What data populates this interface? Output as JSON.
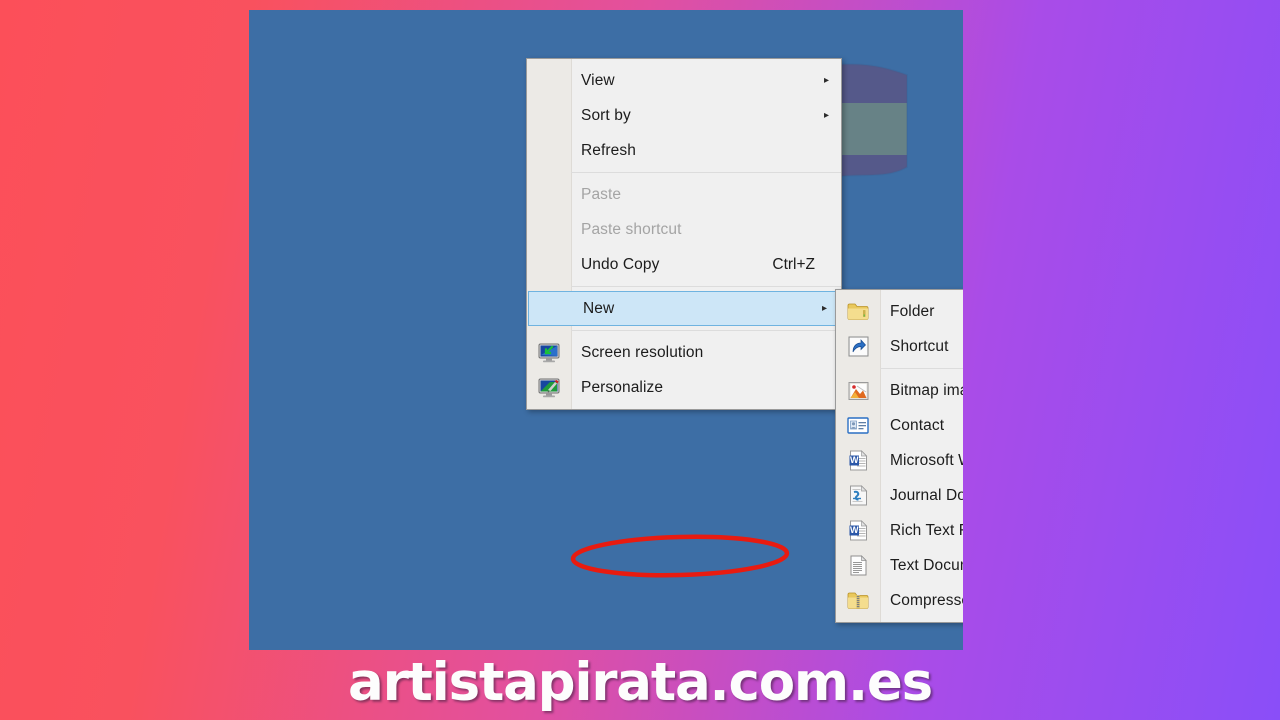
{
  "background": {
    "gradient_from": "#fc4f59",
    "gradient_to": "#8a4ef8",
    "desktop_color": "#3d6ea5"
  },
  "wallpaper": {
    "name": "spain-flag-wallpaper",
    "description": "Waving Spanish flag"
  },
  "context_menu": {
    "name": "desktop-context-menu",
    "items": [
      {
        "label": "View",
        "accel": "",
        "arrow": "▸",
        "state": "normal",
        "icon": ""
      },
      {
        "label": "Sort by",
        "accel": "",
        "arrow": "▸",
        "state": "normal",
        "icon": ""
      },
      {
        "label": "Refresh",
        "accel": "",
        "arrow": "",
        "state": "normal",
        "icon": ""
      },
      {
        "label": "Paste",
        "accel": "",
        "arrow": "",
        "state": "disabled",
        "icon": ""
      },
      {
        "label": "Paste shortcut",
        "accel": "",
        "arrow": "",
        "state": "disabled",
        "icon": ""
      },
      {
        "label": "Undo Copy",
        "accel": "Ctrl+Z",
        "arrow": "",
        "state": "normal",
        "icon": ""
      },
      {
        "label": "New",
        "accel": "",
        "arrow": "▸",
        "state": "highlight",
        "icon": ""
      },
      {
        "label": "Screen resolution",
        "accel": "",
        "arrow": "",
        "state": "normal",
        "icon": "monitor-resolution-icon"
      },
      {
        "label": "Personalize",
        "accel": "",
        "arrow": "",
        "state": "normal",
        "icon": "monitor-brush-icon"
      }
    ]
  },
  "new_submenu": {
    "name": "new-submenu",
    "items": [
      {
        "label": "Folder",
        "icon": "folder-icon"
      },
      {
        "label": "Shortcut",
        "icon": "shortcut-icon"
      },
      {
        "label": "Bitmap image",
        "icon": "bitmap-image-icon"
      },
      {
        "label": "Contact",
        "icon": "contact-icon"
      },
      {
        "label": "Microsoft Word Document",
        "icon": "word-document-icon"
      },
      {
        "label": "Journal Document",
        "icon": "journal-document-icon"
      },
      {
        "label": "Rich Text Format",
        "icon": "rich-text-icon"
      },
      {
        "label": "Text Document",
        "icon": "text-document-icon"
      },
      {
        "label": "Compressed (zipped) Folder",
        "icon": "zipped-folder-icon"
      }
    ]
  },
  "annotation": {
    "name": "text-document-highlight-ellipse",
    "color": "#e81b10",
    "target_label": "Text Document"
  },
  "watermark": {
    "text": "artistapirata.com.es"
  }
}
